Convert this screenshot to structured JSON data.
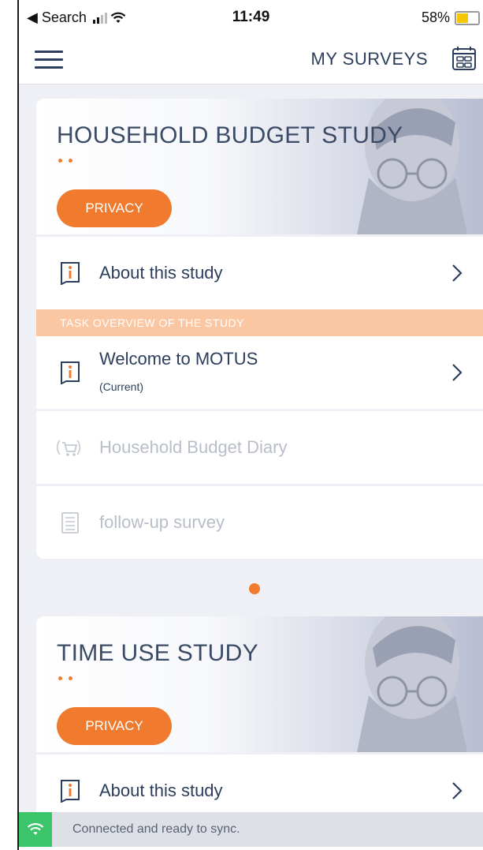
{
  "status_bar": {
    "back_label": "◀ Search",
    "time": "11:49",
    "battery": "58%"
  },
  "header": {
    "title": "MY SURVEYS",
    "menu_icon": "hamburger-menu-icon",
    "calendar_icon": "calendar-icon"
  },
  "surveys": [
    {
      "title": "HOUSEHOLD BUDGET STUDY",
      "privacy_label": "PRIVACY",
      "about_label": "About this study",
      "section_label": "TASK OVERVIEW OF THE STUDY",
      "tasks": [
        {
          "label": "Welcome to MOTUS",
          "status": "(Current)",
          "icon": "info-icon",
          "enabled": true
        },
        {
          "label": "Household Budget Diary",
          "icon": "shopping-cart-icon",
          "enabled": false
        },
        {
          "label": "follow-up survey",
          "icon": "checklist-icon",
          "enabled": false
        }
      ]
    },
    {
      "title": "TIME USE STUDY",
      "privacy_label": "PRIVACY",
      "about_label": "About this study"
    }
  ],
  "connection": {
    "text": "Connected and ready to sync.",
    "icon": "wifi-icon",
    "color": "#3cc46b"
  },
  "colors": {
    "accent": "#f07a2e",
    "section_bar": "#fbc7a3",
    "text": "#2c3e5c"
  }
}
